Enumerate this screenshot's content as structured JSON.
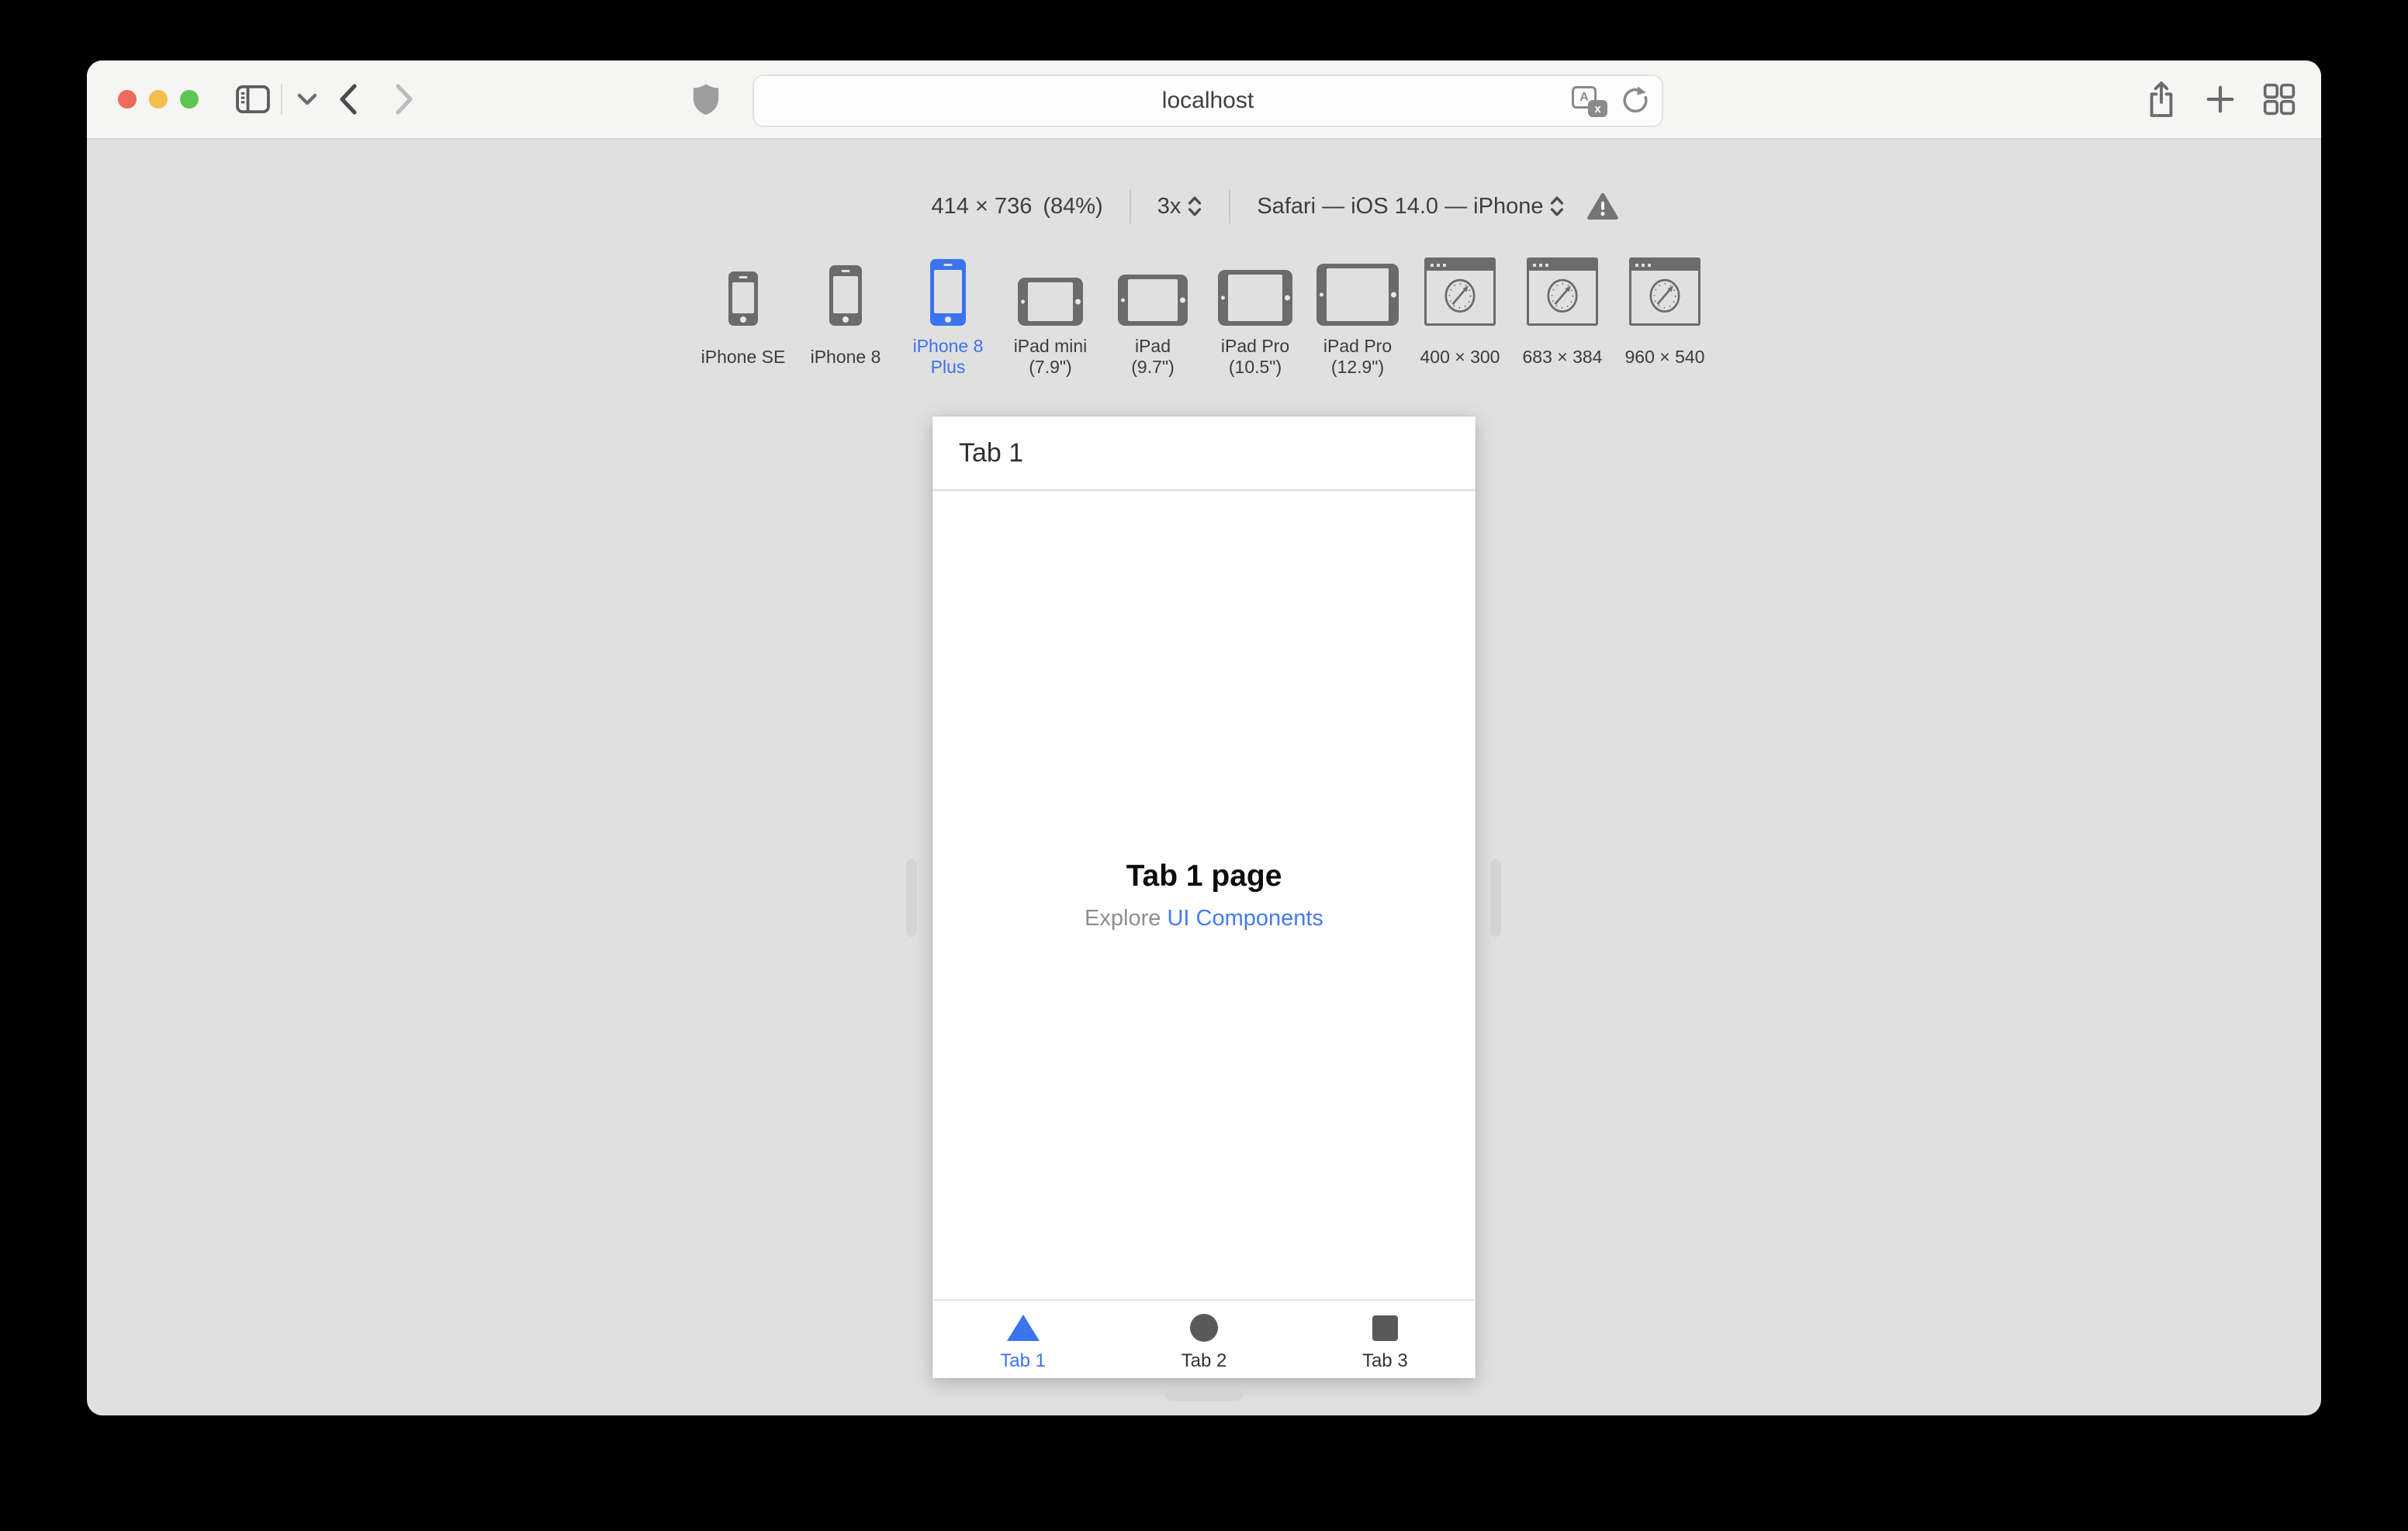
{
  "window": {
    "address": "localhost"
  },
  "rdm": {
    "size": "414 × 736",
    "zoom": "(84%)",
    "scale": "3x",
    "user_agent": "Safari — iOS 14.0 — iPhone",
    "devices": [
      {
        "line1": "iPhone SE",
        "selected": false
      },
      {
        "line1": "iPhone 8",
        "selected": false
      },
      {
        "line1": "iPhone 8",
        "line2": "Plus",
        "selected": true
      },
      {
        "line1": "iPad mini",
        "line2": "(7.9\")",
        "selected": false
      },
      {
        "line1": "iPad",
        "line2": "(9.7\")",
        "selected": false
      },
      {
        "line1": "iPad Pro",
        "line2": "(10.5\")",
        "selected": false
      },
      {
        "line1": "iPad Pro",
        "line2": "(12.9\")",
        "selected": false
      },
      {
        "line1": "400 × 300",
        "selected": false
      },
      {
        "line1": "683 × 384",
        "selected": false
      },
      {
        "line1": "960 × 540",
        "selected": false
      }
    ]
  },
  "preview": {
    "nav_title": "Tab 1",
    "page_title": "Tab 1 page",
    "subtitle_prefix": "Explore ",
    "link_text": "UI Components",
    "tabs": [
      {
        "label": "Tab 1",
        "icon": "triangle",
        "active": true
      },
      {
        "label": "Tab 2",
        "icon": "circle",
        "active": false
      },
      {
        "label": "Tab 3",
        "icon": "square",
        "active": false
      }
    ]
  },
  "colors": {
    "accent_blue": "#3b73f0",
    "link_blue": "#447af3",
    "content_background": "#e0e0e0",
    "titlebar_background": "#f5f5f4",
    "device_icon_gray": "#6b6b6b"
  }
}
